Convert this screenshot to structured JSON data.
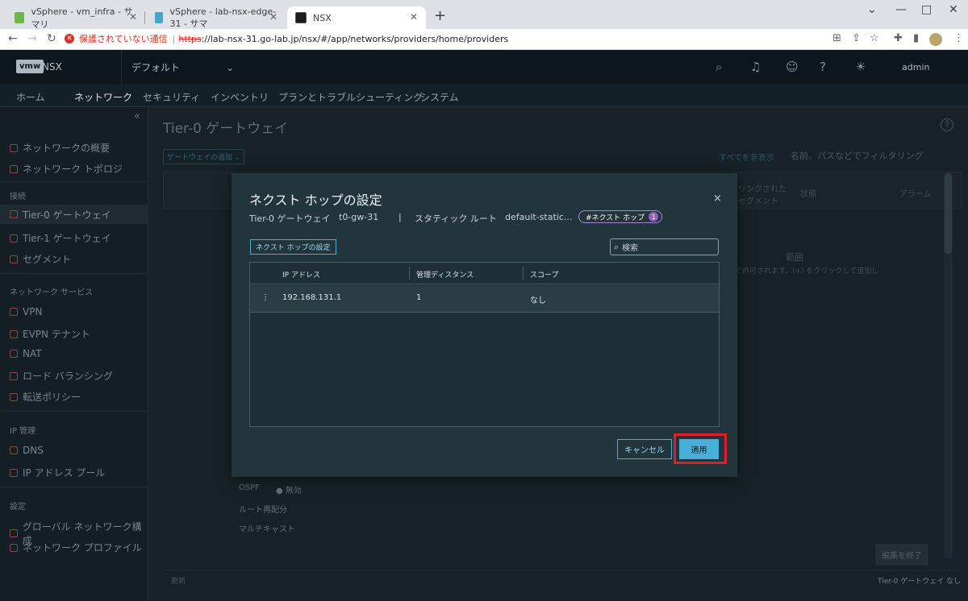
{
  "browser": {
    "tabs": [
      {
        "title": "vSphere - vm_infra - サマリ"
      },
      {
        "title": "vSphere - lab-nsx-edge-31 - サマ"
      },
      {
        "title": "NSX"
      }
    ],
    "window_controls": [
      "⌄",
      "—",
      "□",
      "✕"
    ],
    "security_warning": "保護されていない通信",
    "url_scheme": "https",
    "url_rest": "://lab-nsx-31.go-lab.jp/nsx/#/app/networks/providers/home/providers"
  },
  "header": {
    "logo": "vmw",
    "product": "NSX",
    "project": "デフォルト",
    "user": "admin"
  },
  "mainnav": {
    "items": [
      "ホーム",
      "ネットワーク",
      "セキュリティ",
      "インベントリ",
      "プランとトラブルシューティング",
      "システム"
    ]
  },
  "sidebar": {
    "collapse": "«",
    "overview": "ネットワークの概要",
    "topology": "ネットワーク トポロジ",
    "group_connect": "接続",
    "tier0": "Tier-0 ゲートウェイ",
    "tier1": "Tier-1 ゲートウェイ",
    "segment": "セグメント",
    "group_services": "ネットワーク サービス",
    "vpn": "VPN",
    "evpn": "EVPN テナント",
    "nat": "NAT",
    "lb": "ロード バランシング",
    "forwarding": "転送ポリシー",
    "group_ip": "IP 管理",
    "dns": "DNS",
    "ippool": "IP アドレス プール",
    "group_settings": "設定",
    "global": "グローバル ネットワーク構成",
    "profiles": "ネットワーク プロファイル"
  },
  "content": {
    "title": "Tier-0 ゲートウェイ",
    "help": "?",
    "add_gateway": "ゲートウェイの追加 ⌄",
    "collapse_all": "すべてを非表示",
    "filter_placeholder": "名前、パスなどでフィルタリング",
    "col_linked": "リンクされたセグメント",
    "col_status": "状態",
    "col_alarm": "アラーム",
    "range_label": "範囲",
    "range_hint": "で許可されます。(+) をクリックして追加し",
    "ospf": "OSPF",
    "ospf_state": "● 無効",
    "route_redist": "ルート再配分",
    "multicast": "マルチキャスト",
    "edit_done": "編集を終了",
    "refresh": "更新",
    "footer_right": "Tier-0 ゲートウェイ なし"
  },
  "modal": {
    "title": "ネクスト ホップの設定",
    "close": "×",
    "crumb_gw_label": "Tier-0 ゲートウェイ",
    "crumb_gw": "t0-gw-31",
    "crumb_sep": "|",
    "crumb_route_label": "スタティック ルート",
    "crumb_route": "default-static...",
    "badge": "#ネクスト ホップ",
    "badge_count": "1",
    "set_button": "ネクスト ホップの設定",
    "search_placeholder": "検索",
    "columns": [
      "IP アドレス",
      "管理ディスタンス",
      "スコープ"
    ],
    "rows": [
      {
        "ip": "192.168.131.1",
        "distance": "1",
        "scope": "なし"
      }
    ],
    "cancel": "キャンセル",
    "apply": "適用"
  }
}
